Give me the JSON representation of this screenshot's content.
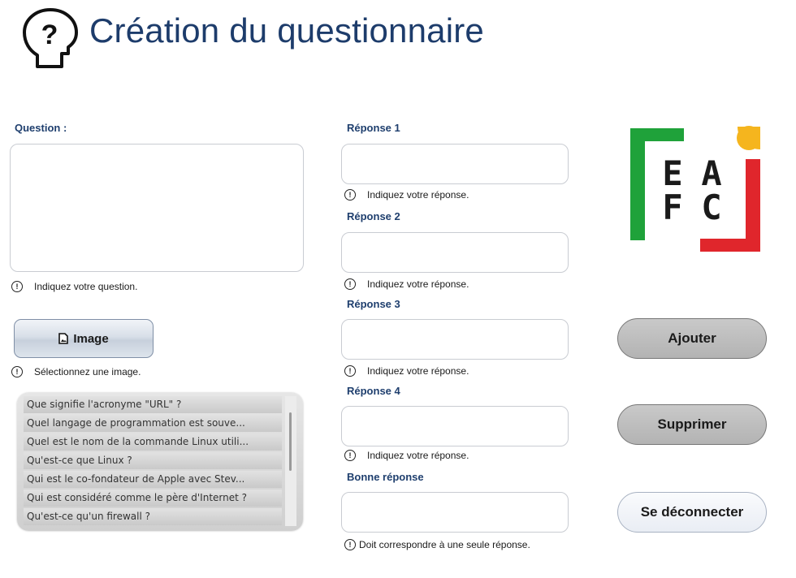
{
  "header": {
    "title": "Création du questionnaire",
    "icon": "head-question-icon"
  },
  "question": {
    "label": "Question :",
    "value": "",
    "hint": "Indiquez votre question."
  },
  "image": {
    "button_label": "Image",
    "hint": "Sélectionnez une image."
  },
  "questions_list": {
    "items": [
      "Que signifie l'acronyme \"URL\" ?",
      "Quel langage de programmation est souve...",
      "Quel est le nom de la commande Linux utili...",
      "Qu'est-ce que Linux ?",
      "Qui est le co-fondateur de Apple avec Stev...",
      "Qui est considéré comme le père d'Internet ?",
      "Qu'est-ce qu'un firewall ?"
    ]
  },
  "answers": {
    "r1": {
      "label": "Réponse 1",
      "value": "",
      "hint": "Indiquez votre réponse."
    },
    "r2": {
      "label": "Réponse 2",
      "value": "",
      "hint": "Indiquez votre réponse."
    },
    "r3": {
      "label": "Réponse 3",
      "value": "",
      "hint": "Indiquez votre réponse."
    },
    "r4": {
      "label": "Réponse 4",
      "value": "",
      "hint": "Indiquez votre réponse."
    },
    "correct": {
      "label": "Bonne réponse",
      "value": "",
      "hint": "Doit correspondre à une seule réponse."
    }
  },
  "logo": {
    "letters": [
      "E",
      "A",
      "F",
      "C"
    ],
    "colors": {
      "green": "#1fa23a",
      "red": "#e0262c",
      "yellow": "#f5b51e"
    }
  },
  "actions": {
    "add_label": "Ajouter",
    "delete_label": "Supprimer",
    "logout_label": "Se déconnecter"
  },
  "colors": {
    "title": "#1d3c6b",
    "label": "#1f3f6e"
  }
}
